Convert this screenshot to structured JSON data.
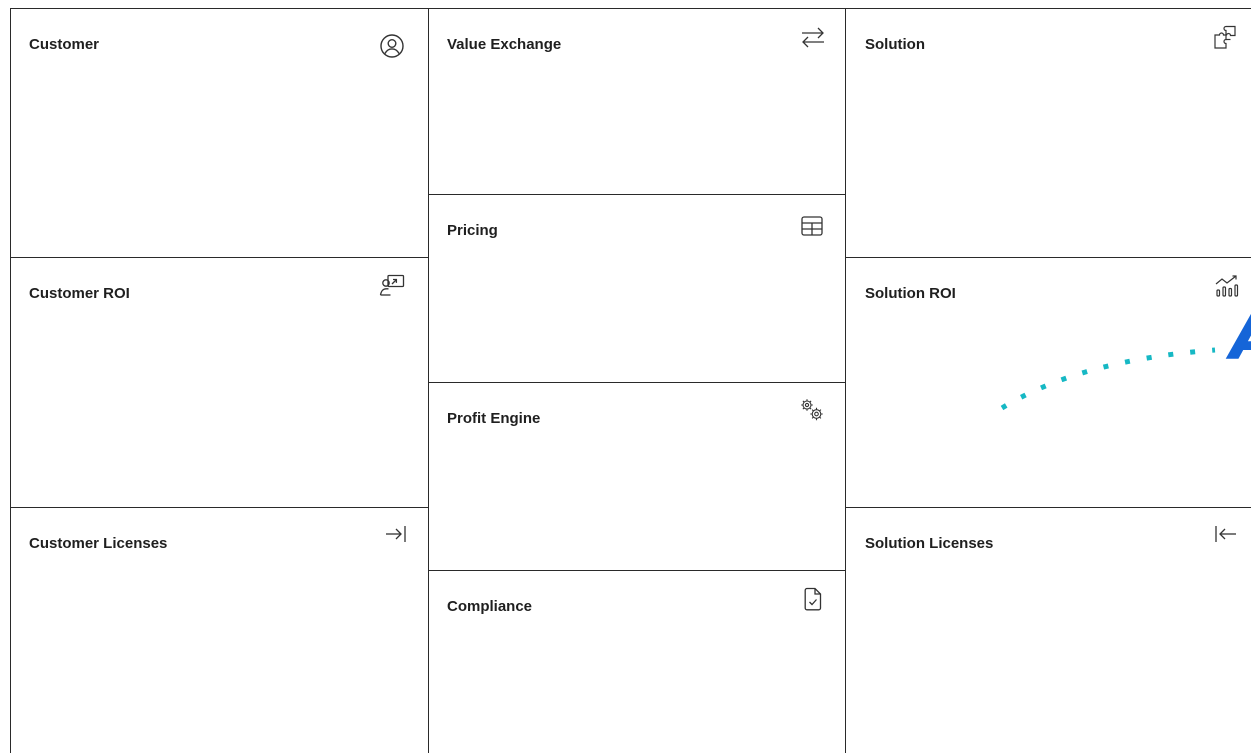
{
  "canvas": {
    "cells": {
      "customer": {
        "title": "Customer",
        "icon": "user-circle-icon"
      },
      "customer_roi": {
        "title": "Customer ROI",
        "icon": "presentation-chart-icon"
      },
      "customer_licenses": {
        "title": "Customer Licenses",
        "icon": "arrow-right-to-bar-icon"
      },
      "value_exchange": {
        "title": "Value Exchange",
        "icon": "arrows-exchange-icon"
      },
      "pricing": {
        "title": "Pricing",
        "icon": "table-icon"
      },
      "profit_engine": {
        "title": "Profit Engine",
        "icon": "gears-icon"
      },
      "compliance": {
        "title": "Compliance",
        "icon": "document-check-icon"
      },
      "solution": {
        "title": "Solution",
        "icon": "puzzle-icon"
      },
      "solution_roi": {
        "title": "Solution ROI",
        "icon": "bar-chart-trend-icon"
      },
      "solution_licenses": {
        "title": "Solution Licenses",
        "icon": "arrow-left-from-bar-icon"
      }
    }
  },
  "branding": {
    "partial_logo_letter": "A",
    "logo_color": "#1565d8",
    "dotted_path_color": "#16b8c4"
  },
  "colors": {
    "grid_line": "#2a2a2a",
    "title_text": "#1f1f1f",
    "background": "#ffffff"
  }
}
